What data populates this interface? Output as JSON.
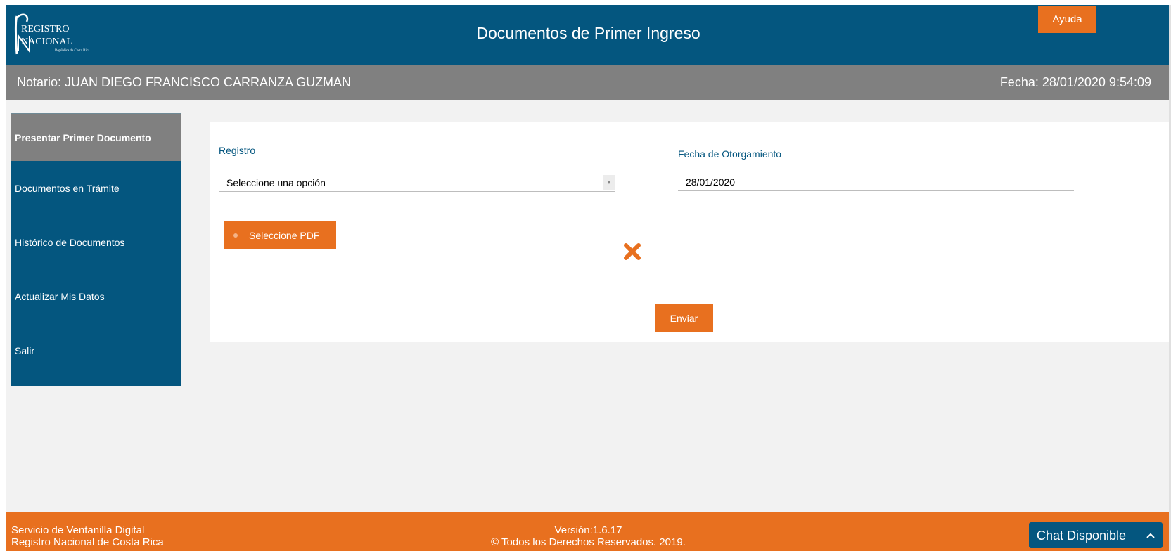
{
  "header": {
    "logo_text": [
      "REGISTRO",
      "NACIONAL",
      "República de Costa Rica"
    ],
    "title": "Documentos de Primer Ingreso",
    "help_label": "Ayuda"
  },
  "subheader": {
    "notary": "Notario: JUAN DIEGO FRANCISCO CARRANZA GUZMAN",
    "date": "Fecha: 28/01/2020 9:54:09"
  },
  "sidebar": {
    "items": [
      {
        "label": "Presentar Primer Documento",
        "active": true
      },
      {
        "label": "Documentos en Trámite",
        "active": false
      },
      {
        "label": "Histórico de Documentos",
        "active": false
      },
      {
        "label": "Actualizar Mis Datos",
        "active": false
      },
      {
        "label": "Salir",
        "active": false
      }
    ]
  },
  "form": {
    "registro_label": "Registro",
    "registro_value": "Seleccione una opción",
    "fecha_label": "Fecha de Otorgamiento",
    "fecha_value": "28/01/2020",
    "pdf_button": "Seleccione PDF",
    "send_button": "Enviar"
  },
  "footer": {
    "left_line1": "Servicio de Ventanilla Digital",
    "left_line2": "Registro Nacional de Costa Rica",
    "version": "Versión:1.6.17",
    "copyright": "© Todos los Derechos Reservados. 2019.",
    "chat_label": "Chat Disponible"
  },
  "colors": {
    "primary_blue": "#04567f",
    "accent_orange": "#e8701f",
    "gray_bar": "#808080",
    "background": "#f2f2f2"
  }
}
